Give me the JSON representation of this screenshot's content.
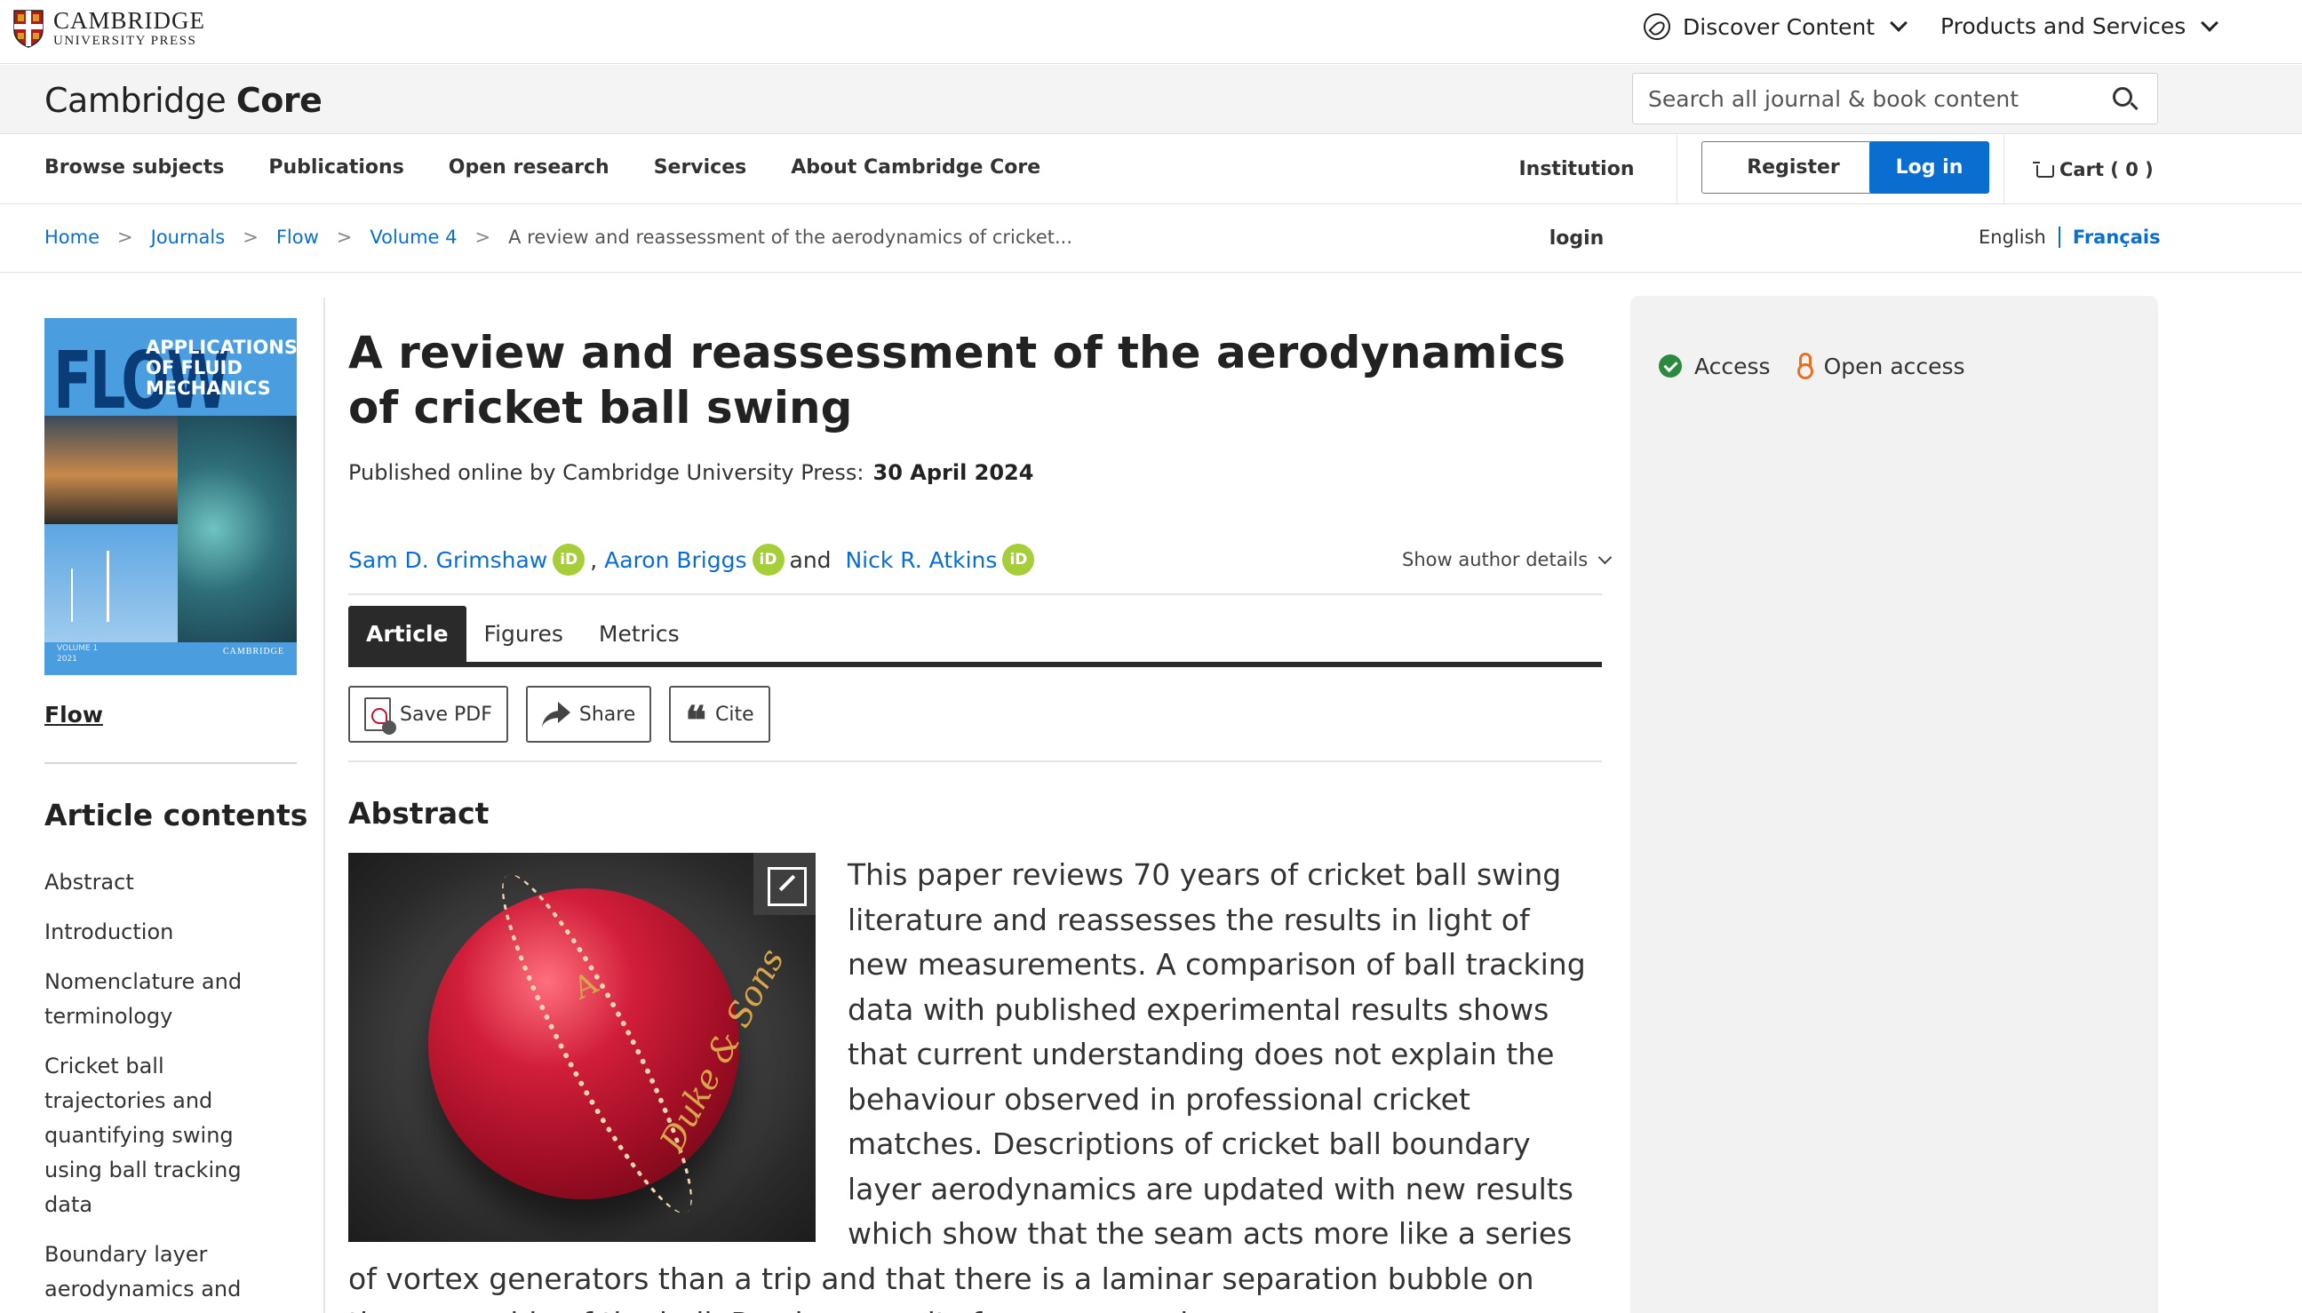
{
  "header": {
    "brand_line1": "CAMBRIDGE",
    "brand_line2": "UNIVERSITY PRESS",
    "discover_label": "Discover Content",
    "products_label": "Products and Services"
  },
  "corebar": {
    "logo_light": "Cambridge",
    "logo_bold": "Core",
    "search_placeholder": "Search all journal & book content"
  },
  "nav": {
    "items": [
      "Browse subjects",
      "Publications",
      "Open research",
      "Services",
      "About Cambridge Core"
    ],
    "institution_login": "Institution login",
    "register": "Register",
    "login": "Log in",
    "cart": "Cart ( 0 )"
  },
  "breadcrumb": {
    "items": [
      "Home",
      "Journals",
      "Flow",
      "Volume 4"
    ],
    "current": "A review and reassessment of the aerodynamics of cricket...",
    "sep": ">"
  },
  "language": {
    "english": "English",
    "french": "Français"
  },
  "sidebar": {
    "cover": {
      "title": "FLOW",
      "subtitle_l1": "APPLICATIONS",
      "subtitle_l2": "OF FLUID",
      "subtitle_l3": "MECHANICS",
      "volume": "VOLUME 1",
      "year": "2021",
      "publisher": "CAMBRIDGE"
    },
    "journal_link": "Flow",
    "contents_title": "Article contents",
    "contents": [
      "Abstract",
      "Introduction",
      "Nomenclature and terminology",
      "Cricket ball trajectories and quantifying swing using ball tracking data",
      "Boundary layer aerodynamics and"
    ]
  },
  "article": {
    "title": "A review and reassessment of the aerodynamics of cricket ball swing",
    "published_prefix": "Published online by Cambridge University Press:",
    "published_date": "30 April 2024",
    "authors": [
      "Sam D. Grimshaw",
      "Aaron Briggs",
      "Nick R. Atkins"
    ],
    "author_sep": ",",
    "author_and": "and",
    "orcid_label": "iD",
    "show_author_details": "Show author details",
    "tabs": [
      "Article",
      "Figures",
      "Metrics"
    ],
    "actions": {
      "save_pdf": "Save PDF",
      "share": "Share",
      "cite": "Cite"
    },
    "cite_glyph": "❝",
    "abstract_heading": "Abstract",
    "figure_ball_text": "Duke & Sons",
    "figure_ball_letter": "A",
    "abstract_text": "This paper reviews 70 years of cricket ball swing literature and reassesses the results in light of new measurements. A comparison of ball tracking data with published experimental results shows that current understanding does not explain the behaviour observed in professional cricket matches. Descriptions of cricket ball boundary layer aerodynamics are updated with new results which show that the seam acts more like a series of vortex generators than a trip and that there is a laminar separation bubble on the seam side of the ball. Previous results for reverse swing are"
  },
  "access": {
    "access_label": "Access",
    "open_access_label": "Open access"
  },
  "colors": {
    "link_blue": "#0a6ed1",
    "orcid_green": "#a6ce39",
    "access_green": "#2b8a3e",
    "open_access_orange": "#e6701e"
  }
}
